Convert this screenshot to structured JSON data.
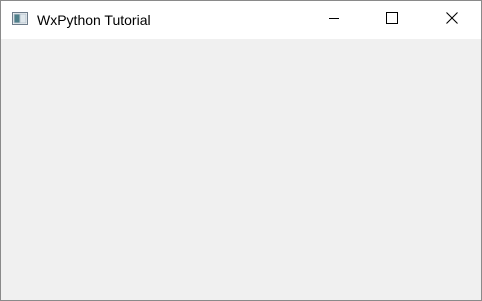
{
  "window": {
    "title": "WxPython Tutorial",
    "icon": "app-window-icon",
    "controls": {
      "minimize_icon": "minimize-icon",
      "maximize_icon": "maximize-icon",
      "close_icon": "close-icon"
    }
  },
  "colors": {
    "titlebar_bg": "#ffffff",
    "client_bg": "#f0f0f0",
    "border": "#8a8a8a"
  }
}
